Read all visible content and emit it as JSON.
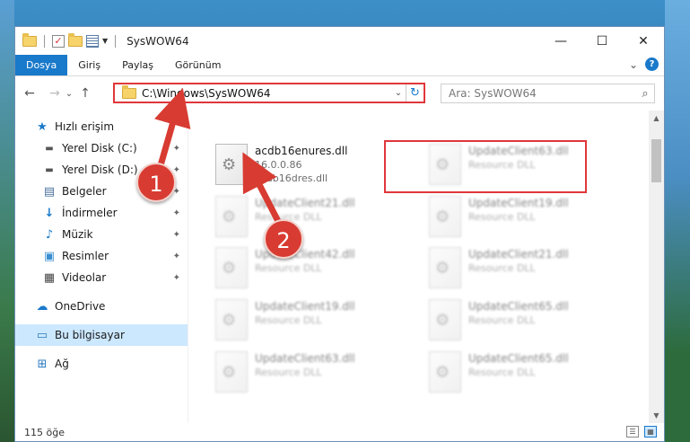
{
  "window": {
    "title": "SysWOW64",
    "controls": {
      "minimize": "—",
      "maximize": "☐",
      "close": "✕"
    }
  },
  "ribbon": {
    "tabs": [
      "Dosya",
      "Giriş",
      "Paylaş",
      "Görünüm"
    ],
    "collapse": "⌄",
    "help": "?"
  },
  "navigation": {
    "back": "←",
    "forward": "→",
    "recent": "⌄",
    "up": "↑",
    "address": "C:\\Windows\\SysWOW64",
    "address_dropdown": "⌄",
    "refresh": "↻",
    "search_placeholder": "Ara: SysWOW64",
    "search_icon": "⌕"
  },
  "sidebar": {
    "quick_access": {
      "label": "Hızlı erişim",
      "icon": "star-icon"
    },
    "items": [
      {
        "label": "Yerel Disk (C:)",
        "icon": "drive-icon",
        "pinned": true
      },
      {
        "label": "Yerel Disk (D:)",
        "icon": "drive-icon",
        "pinned": true
      },
      {
        "label": "Belgeler",
        "icon": "document-icon",
        "pinned": true
      },
      {
        "label": "İndirmeler",
        "icon": "download-icon",
        "pinned": true
      },
      {
        "label": "Müzik",
        "icon": "music-icon",
        "pinned": true
      },
      {
        "label": "Resimler",
        "icon": "picture-icon",
        "pinned": true
      },
      {
        "label": "Videolar",
        "icon": "video-icon",
        "pinned": true
      }
    ],
    "onedrive": {
      "label": "OneDrive",
      "icon": "cloud-icon"
    },
    "this_pc": {
      "label": "Bu bilgisayar",
      "icon": "computer-icon",
      "selected": true
    },
    "network": {
      "label": "Ağ",
      "icon": "network-icon"
    },
    "pin_glyph": "📌"
  },
  "files": {
    "highlighted": {
      "name": "acdb16enures.dll",
      "version": "16.0.0.86",
      "description": "acdb16dres.dll"
    },
    "items": [
      {
        "name": "UpdateClient63.dll",
        "type": "Resource DLL"
      },
      {
        "name": "UpdateClient21.dll",
        "type": "Resource DLL"
      },
      {
        "name": "UpdateClient19.dll",
        "type": "Resource DLL"
      },
      {
        "name": "UpdateClient42.dll",
        "type": "Resource DLL"
      },
      {
        "name": "UpdateClient21.dll",
        "type": "Resource DLL"
      },
      {
        "name": "UpdateClient19.dll",
        "type": "Resource DLL"
      },
      {
        "name": "UpdateClient65.dll",
        "type": "Resource DLL"
      },
      {
        "name": "UpdateClient63.dll",
        "type": "Resource DLL"
      },
      {
        "name": "UpdateClient65.dll",
        "type": "Resource DLL"
      }
    ]
  },
  "status": {
    "count": "115 öğe"
  },
  "markers": {
    "one": "1",
    "two": "2"
  },
  "colors": {
    "accent": "#1979ca",
    "highlight": "#e0373b",
    "marker": "#d83b32",
    "selected": "#cce8ff"
  }
}
